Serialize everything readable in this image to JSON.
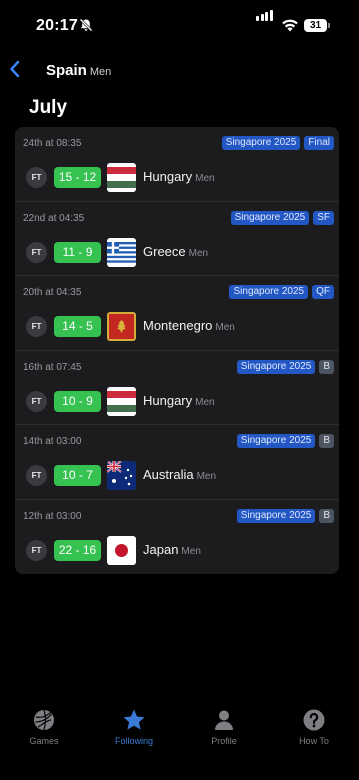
{
  "status": {
    "time": "20:17",
    "battery": "31"
  },
  "nav": {
    "title": "Spain",
    "subtitle": "Men"
  },
  "month": "July",
  "matches": [
    {
      "date": "24th at 08:35",
      "tags": [
        {
          "text": "Singapore 2025",
          "kind": "blue"
        },
        {
          "text": "Final",
          "kind": "blue"
        }
      ],
      "status": "FT",
      "score": "15 - 12",
      "opponent": "Hungary",
      "gender": "Men",
      "flag": "hungary"
    },
    {
      "date": "22nd at 04:35",
      "tags": [
        {
          "text": "Singapore 2025",
          "kind": "blue"
        },
        {
          "text": "SF",
          "kind": "blue"
        }
      ],
      "status": "FT",
      "score": "11 - 9",
      "opponent": "Greece",
      "gender": "Men",
      "flag": "greece"
    },
    {
      "date": "20th at 04:35",
      "tags": [
        {
          "text": "Singapore 2025",
          "kind": "blue"
        },
        {
          "text": "QF",
          "kind": "blue"
        }
      ],
      "status": "FT",
      "score": "14 - 5",
      "opponent": "Montenegro",
      "gender": "Men",
      "flag": "montenegro"
    },
    {
      "date": "16th at 07:45",
      "tags": [
        {
          "text": "Singapore 2025",
          "kind": "blue"
        },
        {
          "text": "B",
          "kind": "grey"
        }
      ],
      "status": "FT",
      "score": "10 - 9",
      "opponent": "Hungary",
      "gender": "Men",
      "flag": "hungary"
    },
    {
      "date": "14th at 03:00",
      "tags": [
        {
          "text": "Singapore 2025",
          "kind": "blue"
        },
        {
          "text": "B",
          "kind": "grey"
        }
      ],
      "status": "FT",
      "score": "10 - 7",
      "opponent": "Australia",
      "gender": "Men",
      "flag": "australia"
    },
    {
      "date": "12th at 03:00",
      "tags": [
        {
          "text": "Singapore 2025",
          "kind": "blue"
        },
        {
          "text": "B",
          "kind": "grey"
        }
      ],
      "status": "FT",
      "score": "22 - 16",
      "opponent": "Japan",
      "gender": "Men",
      "flag": "japan"
    }
  ],
  "tabs": [
    {
      "label": "Games",
      "icon": "ball-icon"
    },
    {
      "label": "Following",
      "icon": "star-icon",
      "active": true
    },
    {
      "label": "Profile",
      "icon": "person-icon"
    },
    {
      "label": "How To",
      "icon": "question-icon"
    }
  ],
  "colors": {
    "accent": "#3a7bd5",
    "score": "#36c251",
    "tag": "#2357c4"
  }
}
